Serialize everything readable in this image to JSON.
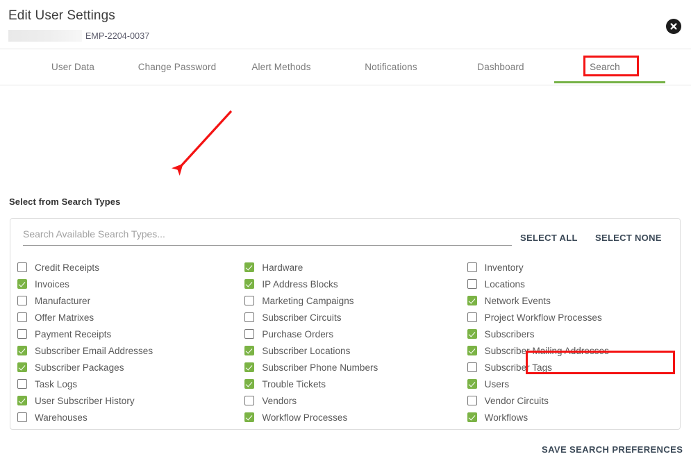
{
  "header": {
    "title": "Edit User Settings",
    "redacted_name": "",
    "employee_id": "EMP-2204-0037",
    "close_icon": "close-circle-icon"
  },
  "tabs": [
    {
      "label": "User Data",
      "active": false
    },
    {
      "label": "Change Password",
      "active": false
    },
    {
      "label": "Alert Methods",
      "active": false
    },
    {
      "label": "Notifications",
      "active": false
    },
    {
      "label": "Dashboard",
      "active": false
    },
    {
      "label": "Search",
      "active": true
    }
  ],
  "main": {
    "section_label": "Select from Search Types",
    "search": {
      "value": "",
      "placeholder": "Search Available Search Types..."
    },
    "select_all_label": "SELECT ALL",
    "select_none_label": "SELECT NONE",
    "save_label": "SAVE SEARCH PREFERENCES"
  },
  "search_types": {
    "column1": [
      {
        "label": "Credit Receipts",
        "checked": false
      },
      {
        "label": "Invoices",
        "checked": true
      },
      {
        "label": "Manufacturer",
        "checked": false
      },
      {
        "label": "Offer Matrixes",
        "checked": false
      },
      {
        "label": "Payment Receipts",
        "checked": false
      },
      {
        "label": "Subscriber Email Addresses",
        "checked": true
      },
      {
        "label": "Subscriber Packages",
        "checked": true
      },
      {
        "label": "Task Logs",
        "checked": false
      },
      {
        "label": "User Subscriber History",
        "checked": true
      },
      {
        "label": "Warehouses",
        "checked": false
      }
    ],
    "column2": [
      {
        "label": "Hardware",
        "checked": true
      },
      {
        "label": "IP Address Blocks",
        "checked": true
      },
      {
        "label": "Marketing Campaigns",
        "checked": false
      },
      {
        "label": "Subscriber Circuits",
        "checked": false
      },
      {
        "label": "Purchase Orders",
        "checked": false
      },
      {
        "label": "Subscriber Locations",
        "checked": true
      },
      {
        "label": "Subscriber Phone Numbers",
        "checked": true
      },
      {
        "label": "Trouble Tickets",
        "checked": true
      },
      {
        "label": "Vendors",
        "checked": false
      },
      {
        "label": "Workflow Processes",
        "checked": true
      }
    ],
    "column3": [
      {
        "label": "Inventory",
        "checked": false
      },
      {
        "label": "Locations",
        "checked": false
      },
      {
        "label": "Network Events",
        "checked": true
      },
      {
        "label": "Project Workflow Processes",
        "checked": false
      },
      {
        "label": "Subscribers",
        "checked": true
      },
      {
        "label": "Subscriber Mailing Addresses",
        "checked": true
      },
      {
        "label": "Subscriber Tags",
        "checked": false
      },
      {
        "label": "Users",
        "checked": true
      },
      {
        "label": "Vendor Circuits",
        "checked": false
      },
      {
        "label": "Workflows",
        "checked": true
      }
    ]
  },
  "annotations": {
    "highlight_color": "#f41313",
    "arrow": "red-arrow-pointing-to-search-panel",
    "boxed_items": [
      "Search",
      "SAVE SEARCH PREFERENCES"
    ]
  },
  "colors": {
    "accent_green": "#76b247",
    "checkbox_green": "#7bb345",
    "button_text": "#3b4957"
  }
}
